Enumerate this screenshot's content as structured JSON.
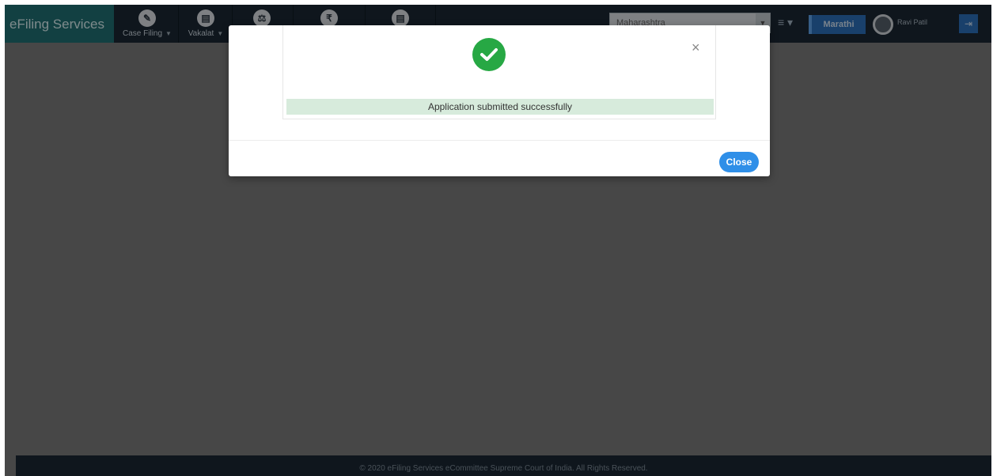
{
  "navbar": {
    "brand": "eFiling Services",
    "items": [
      {
        "label": "Case Filing",
        "icon": "pencil-icon",
        "glyph": "✎"
      },
      {
        "label": "Vakalat",
        "icon": "document-icon",
        "glyph": "▤"
      },
      {
        "label": "",
        "icon": "handshake-icon",
        "glyph": "⚖"
      },
      {
        "label": "",
        "icon": "rupee-icon",
        "glyph": "₹"
      },
      {
        "label": "",
        "icon": "file-icon",
        "glyph": "▤"
      }
    ],
    "state_select_value": "Maharashtra",
    "menu_glyph": "≡ ▾",
    "language_button": "Marathi",
    "user_name": "Ravi Patil",
    "logout_glyph": "⇥"
  },
  "modal": {
    "message": "Application submitted successfully",
    "close_x": "×",
    "close_button": "Close"
  },
  "footer": {
    "text": "© 2020 eFiling Services eCommittee Supreme Court of India. All Rights Reserved."
  },
  "colors": {
    "navbar_bg": "#1a2733",
    "brand_bg": "#1f6f73",
    "success_green": "#27a844",
    "alert_bg": "#d7ebdc",
    "primary_blue": "#2f8fe8"
  }
}
